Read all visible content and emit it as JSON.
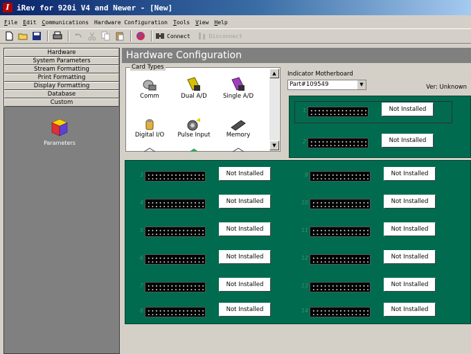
{
  "window": {
    "title": "iRev for 920i V4 and Newer - [New]",
    "app_icon": "I"
  },
  "menu": [
    {
      "key": "F",
      "rest": "ile"
    },
    {
      "key": "E",
      "rest": "dit"
    },
    {
      "key": "C",
      "rest": "ommunications"
    },
    {
      "key": "",
      "rest": "Hardware Configuration"
    },
    {
      "key": "T",
      "rest": "ools"
    },
    {
      "key": "V",
      "rest": "iew"
    },
    {
      "key": "H",
      "rest": "elp"
    }
  ],
  "toolbar": {
    "connect_label": "Connect",
    "disconnect_label": "Disconnect"
  },
  "sidebar": {
    "items": [
      {
        "label": "Hardware"
      },
      {
        "label": "System Parameters"
      },
      {
        "label": "Stream Formatting"
      },
      {
        "label": "Print Formatting"
      },
      {
        "label": "Display Formatting"
      },
      {
        "label": "Database"
      },
      {
        "label": "Custom"
      }
    ],
    "parameters_label": "Parameters"
  },
  "main": {
    "title": "Hardware Configuration",
    "card_types": {
      "legend": "Card Types",
      "items": [
        {
          "label": "Comm",
          "icon": "comm-card-icon"
        },
        {
          "label": "Dual A/D",
          "icon": "dual-ad-card-icon"
        },
        {
          "label": "Single A/D",
          "icon": "single-ad-card-icon"
        },
        {
          "label": "Digital I/O",
          "icon": "digital-io-card-icon"
        },
        {
          "label": "Pulse Input",
          "icon": "pulse-input-card-icon"
        },
        {
          "label": "Memory",
          "icon": "memory-card-icon"
        }
      ]
    },
    "motherboard": {
      "label": "Indicator Motherboard",
      "selected": "Part#109549",
      "version": "Ver: Unknown"
    },
    "slots": [
      {
        "num": "1",
        "status": "Not Installed"
      },
      {
        "num": "2",
        "status": "Not Installed"
      },
      {
        "num": "3",
        "status": "Not Installed"
      },
      {
        "num": "4",
        "status": "Not Installed"
      },
      {
        "num": "5",
        "status": "Not Installed"
      },
      {
        "num": "6",
        "status": "Not Installed"
      },
      {
        "num": "7",
        "status": "Not Installed"
      },
      {
        "num": "8",
        "status": "Not Installed"
      },
      {
        "num": "9",
        "status": "Not Installed"
      },
      {
        "num": "10",
        "status": "Not Installed"
      },
      {
        "num": "11",
        "status": "Not Installed"
      },
      {
        "num": "12",
        "status": "Not Installed"
      },
      {
        "num": "13",
        "status": "Not Installed"
      },
      {
        "num": "14",
        "status": "Not Installed"
      }
    ]
  },
  "colors": {
    "board_green": "#006b4f",
    "title_bar_start": "#0a246a",
    "panel_gray": "#808080"
  }
}
